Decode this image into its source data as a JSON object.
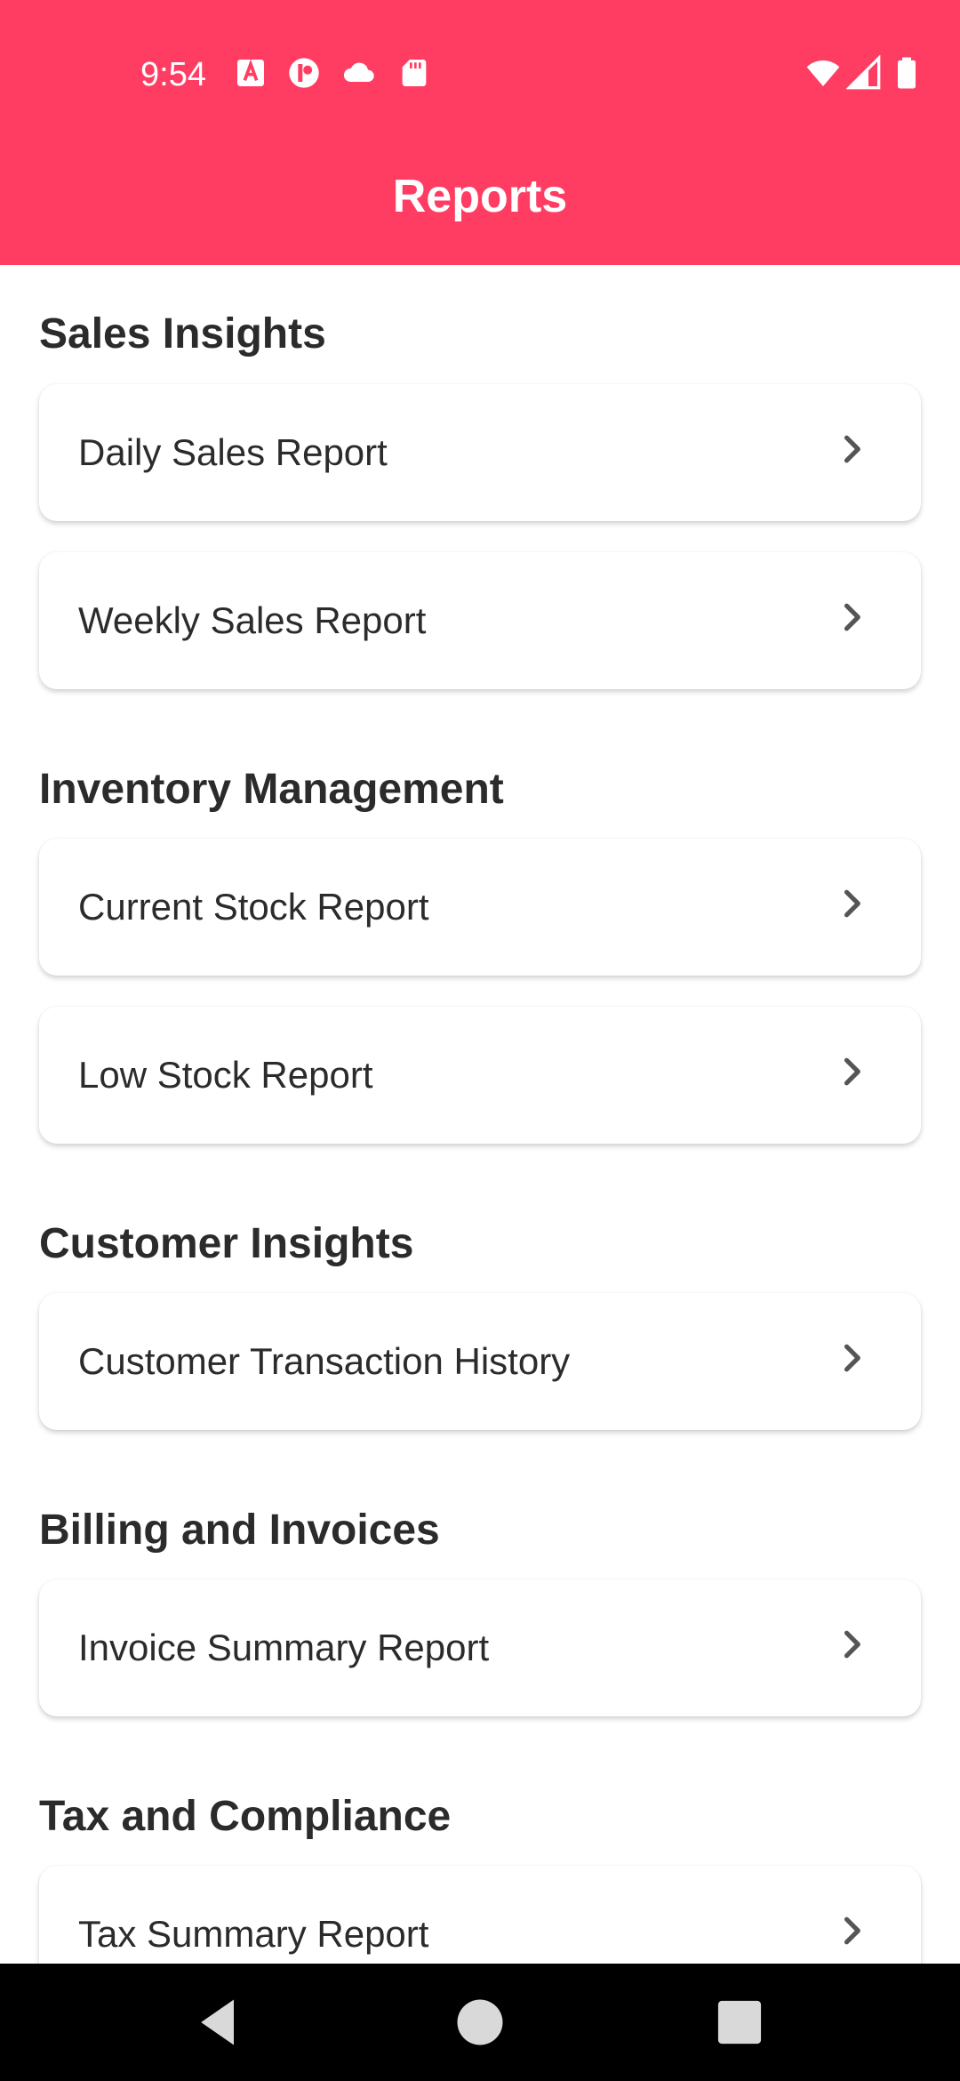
{
  "status_bar": {
    "time": "9:54",
    "icons_left": [
      "font-a-icon",
      "info-circle-icon",
      "cloud-icon",
      "sd-card-icon"
    ],
    "icons_right": [
      "wifi-icon",
      "signal-icon",
      "battery-icon"
    ]
  },
  "header": {
    "title": "Reports",
    "background_color": "#FF3D63"
  },
  "sections": [
    {
      "title": "Sales Insights",
      "items": [
        "Daily Sales Report",
        "Weekly Sales Report"
      ]
    },
    {
      "title": "Inventory Management",
      "items": [
        "Current Stock Report",
        "Low Stock Report"
      ]
    },
    {
      "title": "Customer Insights",
      "items": [
        "Customer Transaction History"
      ]
    },
    {
      "title": "Billing and Invoices",
      "items": [
        "Invoice Summary Report"
      ]
    },
    {
      "title": "Tax and Compliance",
      "items": [
        "Tax Summary Report"
      ]
    }
  ],
  "navigation": {
    "buttons": [
      "back-icon",
      "home-icon",
      "recents-icon"
    ]
  }
}
